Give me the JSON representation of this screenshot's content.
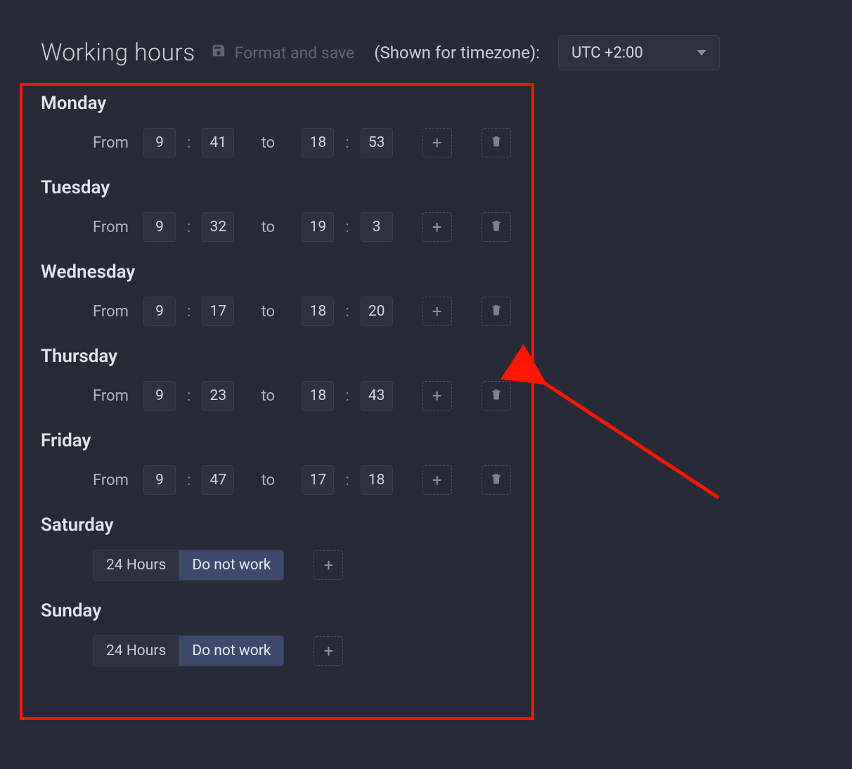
{
  "header": {
    "title": "Working hours",
    "save_label": "Format and save",
    "timezone_label": "(Shown for timezone):",
    "timezone_value": "UTC +2:00"
  },
  "labels": {
    "from": "From",
    "to": "to",
    "colon": ":",
    "hours24": "24 Hours",
    "do_not_work": "Do not work"
  },
  "days": [
    {
      "name": "Monday",
      "mode": "range",
      "from_h": "9",
      "from_m": "41",
      "to_h": "18",
      "to_m": "53"
    },
    {
      "name": "Tuesday",
      "mode": "range",
      "from_h": "9",
      "from_m": "32",
      "to_h": "19",
      "to_m": "3"
    },
    {
      "name": "Wednesday",
      "mode": "range",
      "from_h": "9",
      "from_m": "17",
      "to_h": "18",
      "to_m": "20"
    },
    {
      "name": "Thursday",
      "mode": "range",
      "from_h": "9",
      "from_m": "23",
      "to_h": "18",
      "to_m": "43"
    },
    {
      "name": "Friday",
      "mode": "range",
      "from_h": "9",
      "from_m": "47",
      "to_h": "17",
      "to_m": "18"
    },
    {
      "name": "Saturday",
      "mode": "off"
    },
    {
      "name": "Sunday",
      "mode": "off"
    }
  ]
}
